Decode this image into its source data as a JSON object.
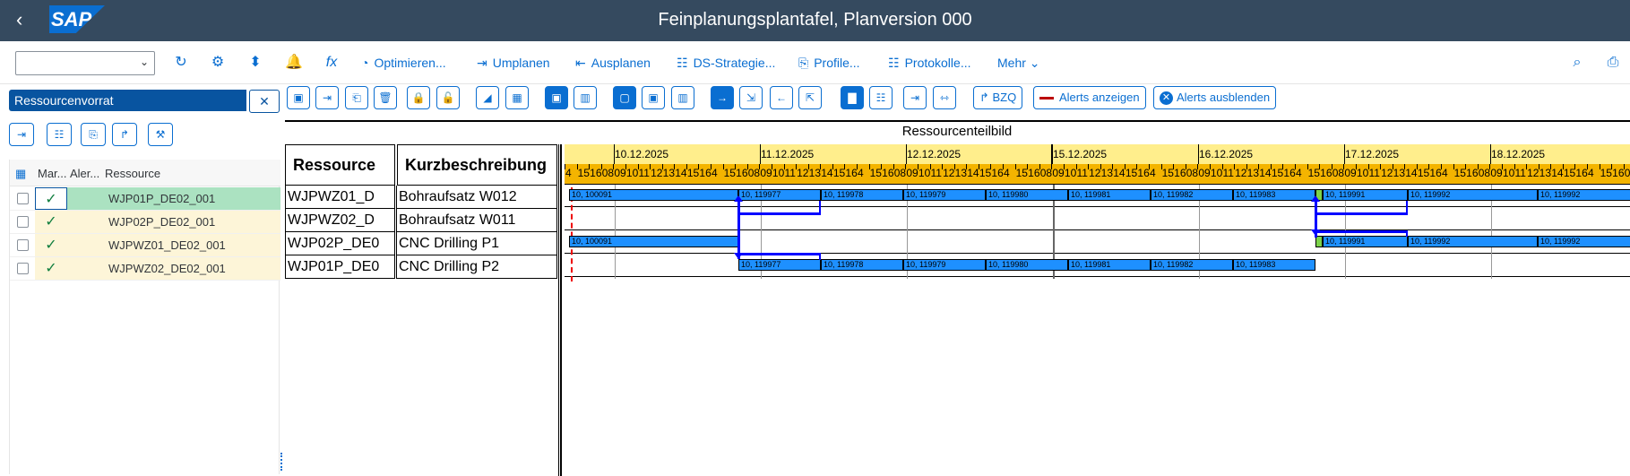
{
  "shell": {
    "title": "Feinplanungsplantafel, Planversion 000",
    "logo": "SAP"
  },
  "toolbar": {
    "dropdown_value": "",
    "buttons": [
      "Optimieren...",
      "Umplanen",
      "Ausplanen",
      "DS-Strategie...",
      "Profile...",
      "Protokolle...",
      "Mehr"
    ]
  },
  "left_panel": {
    "title": "Ressourcenvorrat",
    "columns": [
      "Mar...",
      "Aler...",
      "Ressource"
    ],
    "rows": [
      "WJP01P_DE02_001",
      "WJP02P_DE02_001",
      "WJPWZ01_DE02_001",
      "WJPWZ02_DE02_001"
    ]
  },
  "toolbar2": {
    "bzq": "BZQ",
    "alerts_show": "Alerts anzeigen",
    "alerts_hide": "Alerts ausblenden"
  },
  "board": {
    "title": "Ressourcenteilbild",
    "col_ressource": "Ressource",
    "col_kurz": "Kurzbeschreibung",
    "rows": [
      {
        "res": "WJPWZ01_D",
        "desc": "Bohraufsatz W012"
      },
      {
        "res": "WJPWZ02_D",
        "desc": "Bohraufsatz W011"
      },
      {
        "res": "WJP02P_DE0",
        "desc": "CNC Drilling P1"
      },
      {
        "res": "WJP01P_DE0",
        "desc": "CNC Drilling P2"
      }
    ],
    "dates": [
      "10.12.2025",
      "11.12.2025",
      "12.12.2025",
      "15.12.2025",
      "16.12.2025",
      "17.12.2025",
      "18.12.2025"
    ],
    "hours": [
      "4",
      "15",
      "16",
      "08",
      "09",
      "10",
      "11",
      "12",
      "13",
      "14",
      "15",
      "16"
    ],
    "bars": {
      "r0": [
        "10, 100091",
        "10, 119977",
        "10, 119978",
        "10, 119979",
        "10, 119980",
        "10, 119981",
        "10, 119982",
        "10, 119983",
        "10, 119991",
        "10, 119992",
        "10, 119992"
      ],
      "r2": [
        "10, 100091",
        "10, 119991",
        "10, 119992",
        "10, 119992"
      ],
      "r3": [
        "10, 119977",
        "10, 119978",
        "10, 119979",
        "10, 119980",
        "10, 119981",
        "10, 119982",
        "10, 119983"
      ]
    }
  },
  "colors": {
    "shell": "#354a5f",
    "accent": "#0a6ed1",
    "bar": "#1e90ff",
    "date_bg": "#ffee8c",
    "hour_bg": "#f4b400"
  }
}
